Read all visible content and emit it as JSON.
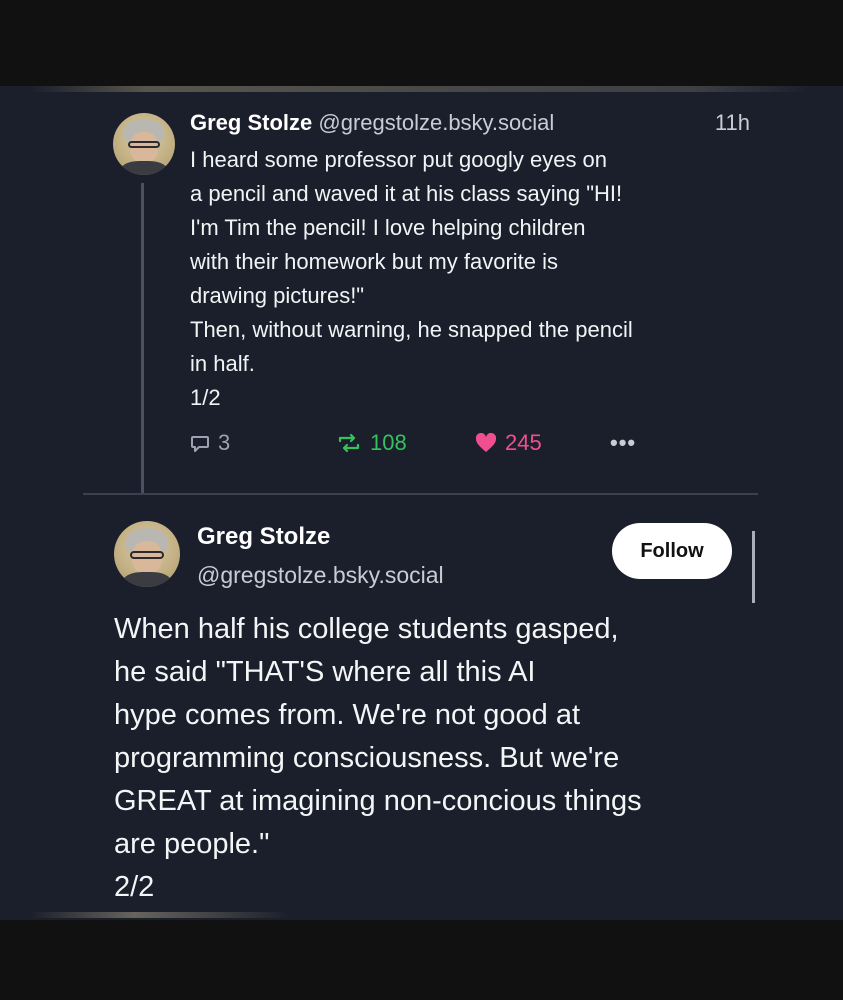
{
  "post1": {
    "author_name": "Greg Stolze",
    "handle": "@gregstolze.bsky.social",
    "timestamp": "11h",
    "lines": [
      "I heard some professor put googly eyes on",
      "a pencil and waved it at his class saying \"HI!",
      "I'm Tim the pencil! I love helping children",
      "with their homework but my favorite is",
      "drawing pictures!\"",
      "Then, without warning, he snapped the pencil",
      "in half.",
      "1/2"
    ],
    "reply_count": "3",
    "repost_count": "108",
    "like_count": "245",
    "more_label": "•••"
  },
  "post2": {
    "author_name": "Greg Stolze",
    "handle": "@gregstolze.bsky.social",
    "follow_label": "Follow",
    "lines": [
      "When half his college students gasped,",
      "he said \"THAT'S where all this AI",
      "hype comes from. We're not good at",
      "programming consciousness. But we're",
      "GREAT at imagining non-concious things",
      "are people.\"",
      "2/2"
    ]
  },
  "icons": {
    "reply": "speech-bubble-icon",
    "repost": "repost-arrows-icon",
    "like": "heart-icon",
    "more": "ellipsis-icon"
  },
  "colors": {
    "background": "#1b1f2b",
    "repost_green": "#35c25d",
    "like_pink": "#ef4f8e",
    "muted_text": "#c9ccd4"
  }
}
